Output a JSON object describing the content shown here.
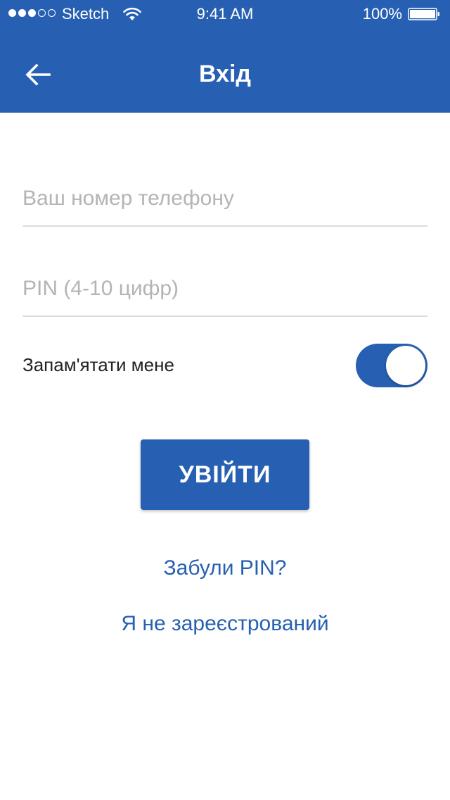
{
  "status_bar": {
    "carrier": "Sketch",
    "time": "9:41 AM",
    "battery_percent": "100%",
    "signal_bars_filled": 3,
    "signal_bars_total": 5
  },
  "header": {
    "title": "Вхід",
    "back_icon": "arrow-left-icon"
  },
  "form": {
    "phone_placeholder": "Ваш номер телефону",
    "phone_value": "",
    "pin_placeholder": "PIN (4-10 цифр)",
    "pin_value": "",
    "remember_label": "Запам'ятати мене",
    "remember_on": true
  },
  "actions": {
    "login_label": "УВІЙТИ",
    "forgot_pin_label": "Забули PIN?",
    "not_registered_label": "Я не зареєстрований"
  },
  "colors": {
    "primary": "#2760b2",
    "placeholder": "#b4b4b4",
    "divider": "#dcdcdc"
  }
}
